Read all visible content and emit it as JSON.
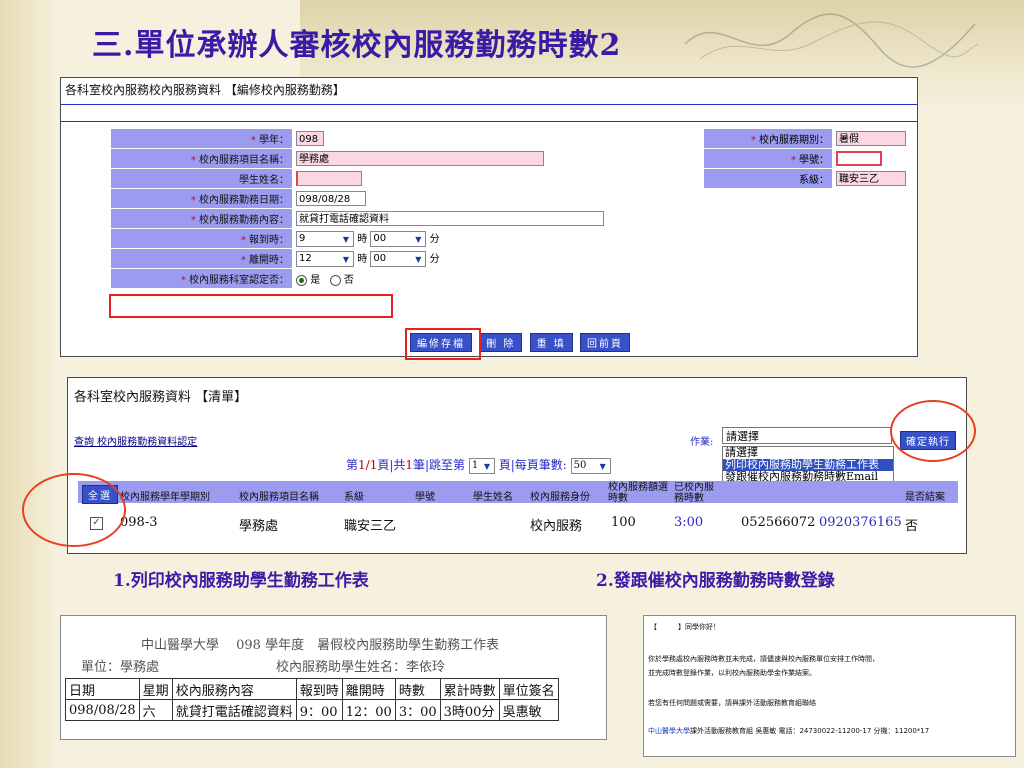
{
  "slide": {
    "title": "三.單位承辦人審核校內服務勤務時數2"
  },
  "edit": {
    "header": "各科室校內服務校內服務資料 【編修校內服務勤務】",
    "labels": {
      "year": "學年：",
      "item_name": "校內服務項目名稱：",
      "student_name": "學生姓名：",
      "duty_date": "校內服務勤務日期：",
      "duty_content": "校內服務勤務內容：",
      "arrive": "報到時：",
      "leave": "離開時：",
      "confirm": "校內服務科室認定否：",
      "period": "校內服務期別：",
      "student_no": "學號：",
      "dept": "系級："
    },
    "values": {
      "year": "098",
      "item_name": "學務處",
      "student_name": "",
      "duty_date": "098/08/28",
      "duty_content": "就貸打電話確認資料",
      "arrive_hour": "9",
      "arrive_min": "00",
      "leave_hour": "12",
      "leave_min": "00",
      "period": "暑假",
      "student_no": "",
      "dept": "職安三乙"
    },
    "units": {
      "hour": "時",
      "min": "分"
    },
    "required_mark": "*",
    "radio": {
      "yes": "是",
      "no": "否"
    },
    "buttons": {
      "save": "編修存檔",
      "delete": "刪 除",
      "reset": "重 填",
      "back": "回前頁"
    }
  },
  "list": {
    "header": "各科室校內服務資料 【清單】",
    "link": "查詢 校內服務勤務資料認定",
    "pager": {
      "prefix": "第",
      "page": "1/1",
      "mid1": "頁|共",
      "total": "1",
      "mid2": "筆|跳至第",
      "goto": "1",
      "mid3": "頁|每頁筆數:",
      "per": "50"
    },
    "action_label": "作業:",
    "action_selected": "請選擇",
    "action_options": [
      "請選擇",
      "列印校內服務助學生勤務工作表",
      "發跟催校內服務勤務時數Email"
    ],
    "run_button": "確定執行",
    "select_all": "全選",
    "columns": [
      "校內服務學年學期別",
      "校內服務項目名稱",
      "系級",
      "學號",
      "學生姓名",
      "校內服務身份",
      "校內服務額選時數",
      "已校內服務時數",
      "",
      "",
      "是否結案"
    ],
    "row": {
      "period": "098-3",
      "item": "學務處",
      "dept": "職安三乙",
      "identity": "校內服務",
      "hours": "100",
      "done": "3:00",
      "phone1": "052566072",
      "phone2": "0920376165",
      "closed": "否"
    }
  },
  "captions": {
    "left": "1.列印校內服務助學生勤務工作表",
    "right": "2.發跟催校內服務勤務時數登錄"
  },
  "worksheet": {
    "line1": "中山醫學大學　 098 學年度　暑假校內服務助學生勤務工作表",
    "line2": "單位：學務處　　　　　　　　　校內服務助學生姓名：李依玲",
    "headers": [
      "日期",
      "星期",
      "校內服務內容",
      "報到時",
      "離開時",
      "時數",
      "累計時數",
      "單位簽名"
    ],
    "row": [
      "098/08/28",
      "六",
      "就貸打電話確認資料",
      "9：00",
      "12：00",
      "3：00",
      "3時00分",
      "吳惠敏"
    ]
  },
  "email": {
    "greeting": "【　　　】同學你好！",
    "body1": "你於學務處校內服務時數並未完成，請儘速與校內服務單位安排工作時間，",
    "body2": "並完成時數登錄作業，以利校內服務助學金作業結案。",
    "body3": "若您有任何問題或需要，請與課外活動服務教育組聯絡",
    "footer_org": "中山醫學大學",
    "footer_rest": "課外活動服務教育組 吳惠敏 電話：24730022-11200-17 分機：11200*17"
  }
}
